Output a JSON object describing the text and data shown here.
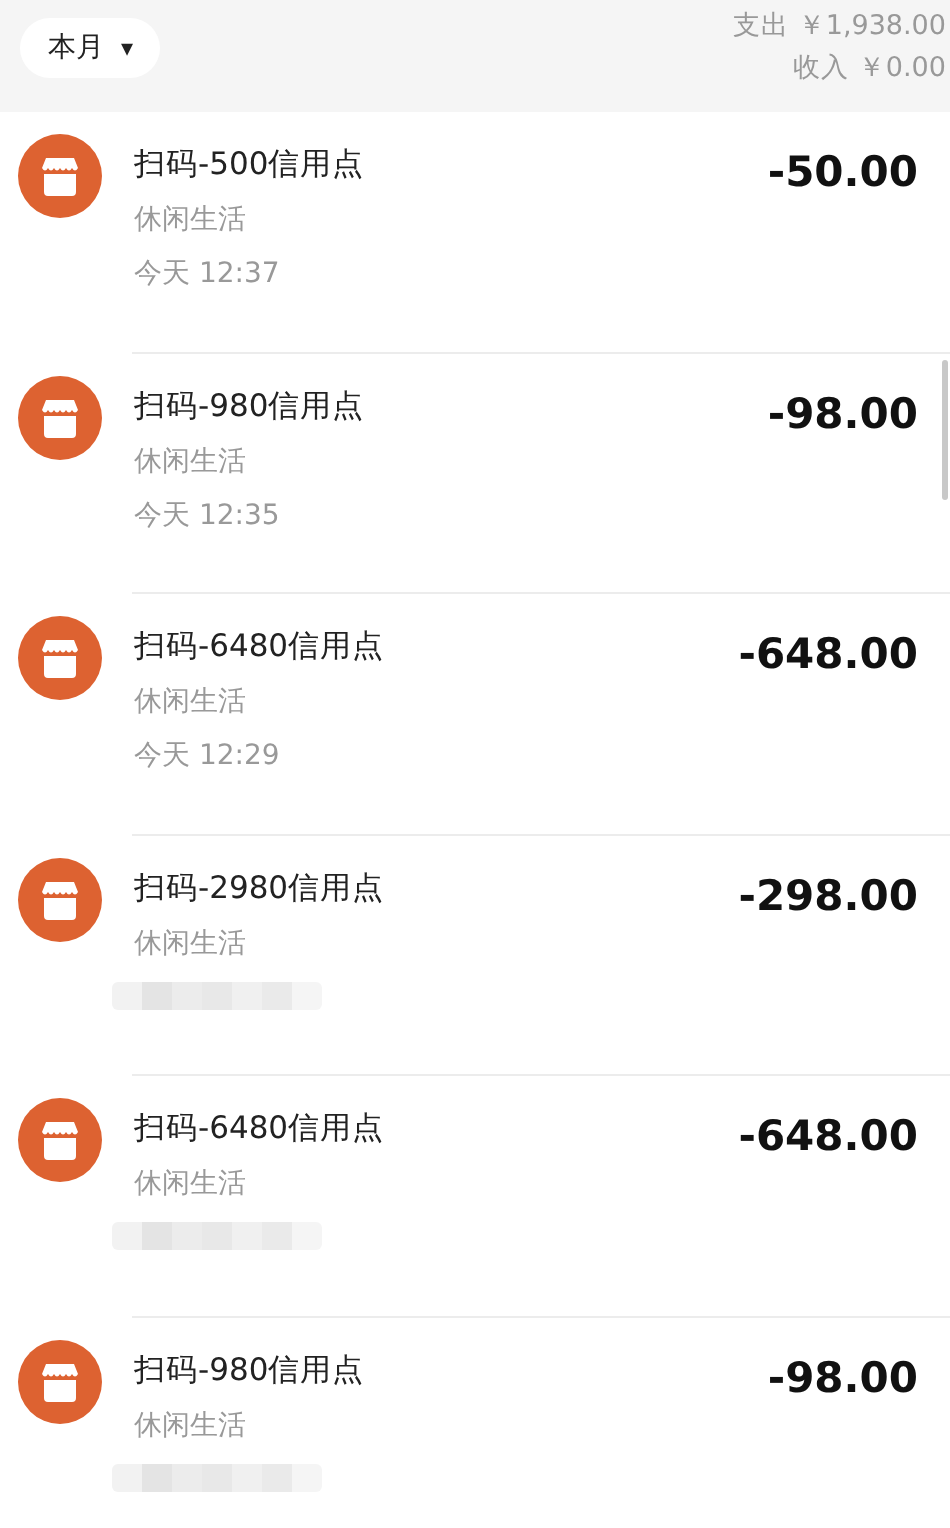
{
  "filter": {
    "label": "本月",
    "caret": "▾"
  },
  "summary": {
    "expense": "支出 ￥1,938.00",
    "income": "收入 ￥0.00"
  },
  "transactions": [
    {
      "title": "扫码-500信用点",
      "category": "休闲生活",
      "time": "今天  12:37",
      "amount": "-50.00",
      "time_hidden": false
    },
    {
      "title": "扫码-980信用点",
      "category": "休闲生活",
      "time": "今天  12:35",
      "amount": "-98.00",
      "time_hidden": false
    },
    {
      "title": "扫码-6480信用点",
      "category": "休闲生活",
      "time": "今天  12:29",
      "amount": "-648.00",
      "time_hidden": false
    },
    {
      "title": "扫码-2980信用点",
      "category": "休闲生活",
      "amount": "-298.00",
      "time_hidden": true
    },
    {
      "title": "扫码-6480信用点",
      "category": "休闲生活",
      "amount": "-648.00",
      "time_hidden": true
    },
    {
      "title": "扫码-980信用点",
      "category": "休闲生活",
      "amount": "-98.00",
      "time_hidden": true
    }
  ]
}
